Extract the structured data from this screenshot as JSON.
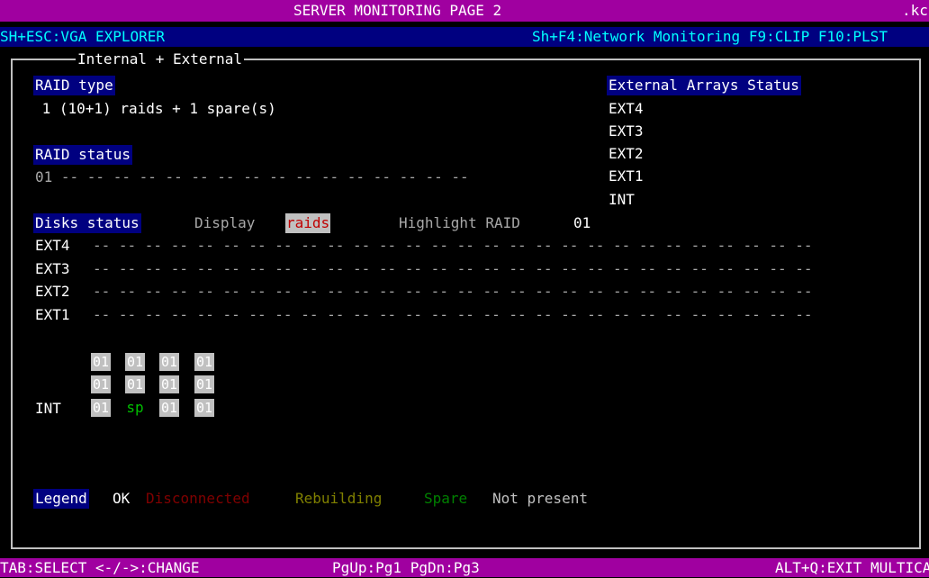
{
  "titlebar": {
    "title": "SERVER MONITORING PAGE 2",
    "right": ".kc"
  },
  "hotkeys": {
    "left": "SH+ESC:VGA EXPLORER",
    "right": "Sh+F4:Network Monitoring F9:CLIP F10:PLST"
  },
  "frame": {
    "label": "Internal + External"
  },
  "raid_type": {
    "header": "RAID type",
    "value": " 1 (10+1) raids + 1 spare(s)"
  },
  "raid_status": {
    "header": "RAID status",
    "value": "01 -- -- -- -- -- -- -- -- -- -- -- -- -- -- -- --"
  },
  "external_arrays": {
    "header": "External Arrays Status",
    "items": [
      "EXT4",
      "EXT3",
      "EXT2",
      "EXT1",
      "INT"
    ]
  },
  "disks_status": {
    "header": "Disks status",
    "display_label": "Display",
    "display_value": "raids",
    "highlight_label": "Highlight RAID",
    "highlight_value": "01",
    "rows": [
      {
        "label": "EXT4",
        "dashes": "-- -- -- -- -- -- -- -- -- -- -- -- -- -- -- -- -- -- -- -- -- -- -- -- -- -- -- --"
      },
      {
        "label": "EXT3",
        "dashes": "-- -- -- -- -- -- -- -- -- -- -- -- -- -- -- -- -- -- -- -- -- -- -- -- -- -- -- --"
      },
      {
        "label": "EXT2",
        "dashes": "-- -- -- -- -- -- -- -- -- -- -- -- -- -- -- -- -- -- -- -- -- -- -- -- -- -- -- --"
      },
      {
        "label": "EXT1",
        "dashes": "-- -- -- -- -- -- -- -- -- -- -- -- -- -- -- -- -- -- -- -- -- -- -- -- -- -- -- --"
      }
    ],
    "int_label": "INT",
    "int_grid": [
      [
        "01",
        "01",
        "01",
        "01"
      ],
      [
        "01",
        "01",
        "01",
        "01"
      ],
      [
        "01",
        "sp",
        "01",
        "01"
      ]
    ]
  },
  "legend": {
    "label": "Legend",
    "items": [
      {
        "text": "OK",
        "color": "#ffffff"
      },
      {
        "text": "Disconnected",
        "color": "#800000"
      },
      {
        "text": "Rebuilding",
        "color": "#808000"
      },
      {
        "text": "Spare",
        "color": "#008000"
      },
      {
        "text": "Not present",
        "color": "#c0c0c0"
      }
    ]
  },
  "footer": {
    "select": "TAB:SELECT <-/->:CHANGE",
    "paging": "PgUp:Pg1 PgDn:Pg3",
    "exit": "ALT+Q:EXIT MULTICAM"
  },
  "colors": {
    "title_bg": "#a000a0",
    "hotkey_bg": "#000080",
    "header_bg": "#000080"
  }
}
